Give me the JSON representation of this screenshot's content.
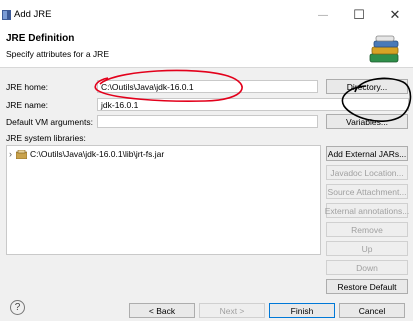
{
  "window": {
    "title": "Add JRE",
    "minimize_label": "—",
    "maximize_label": "☐",
    "close_label": "✕"
  },
  "header": {
    "title": "JRE Definition",
    "subtitle": "Specify attributes for a JRE"
  },
  "form": {
    "jre_home_label": "JRE home:",
    "jre_home_value": "C:\\Outils\\Java\\jdk-16.0.1",
    "jre_name_label": "JRE name:",
    "jre_name_value": "jdk-16.0.1",
    "vm_args_label": "Default VM arguments:",
    "vm_args_value": "",
    "libraries_label": "JRE system libraries:"
  },
  "buttons": {
    "directory": "Directory...",
    "variables": "Variables...",
    "add_external_jars": "Add External JARs...",
    "javadoc_location": "Javadoc Location...",
    "source_attachment": "Source Attachment...",
    "external_annotations": "External annotations...",
    "remove": "Remove",
    "up": "Up",
    "down": "Down",
    "restore_default": "Restore Default"
  },
  "libraries": [
    {
      "path": "C:\\Outils\\Java\\jdk-16.0.1\\lib\\jrt-fs.jar",
      "expander": "›"
    }
  ],
  "footer": {
    "help_label": "?",
    "back": "< Back",
    "next": "Next >",
    "finish": "Finish",
    "cancel": "Cancel"
  },
  "annotations": {
    "color": "#e3001b",
    "black": "#000000"
  }
}
